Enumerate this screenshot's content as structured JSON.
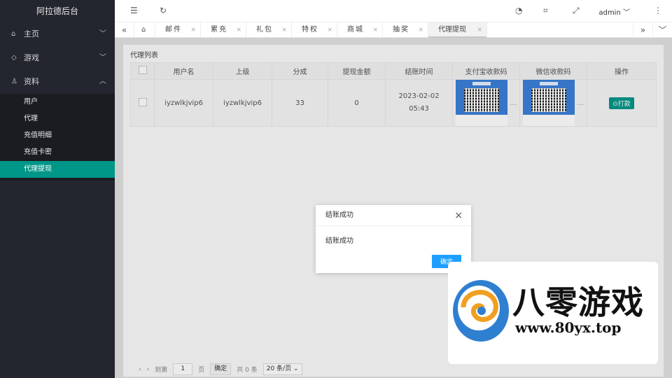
{
  "sidebar": {
    "brand": "阿拉德后台",
    "items": [
      {
        "label": "主页",
        "icon": "home-icon",
        "chevron": "﹀"
      },
      {
        "label": "游戏",
        "icon": "diamond-icon",
        "chevron": "﹀"
      },
      {
        "label": "资料",
        "icon": "user-group-icon",
        "chevron": "︿"
      }
    ],
    "sub_items": [
      "用户",
      "代理",
      "充值明细",
      "充值卡密",
      "代理提现"
    ],
    "active_sub": "代理提现",
    "accent": "#009688"
  },
  "header": {
    "user": "admin"
  },
  "tabs": {
    "items": [
      {
        "label": "邮件"
      },
      {
        "label": "累充"
      },
      {
        "label": "礼包"
      },
      {
        "label": "特权"
      },
      {
        "label": "商城"
      },
      {
        "label": "抽奖"
      },
      {
        "label": "代理提现",
        "active": true
      }
    ]
  },
  "main": {
    "card_title": "代理列表",
    "columns": [
      "用户名",
      "上级",
      "分成",
      "提现金额",
      "结账时间",
      "支付宝收款码",
      "微信收款码",
      "操作"
    ],
    "row": {
      "username": "iyzwlkjvip6",
      "parent": "iyzwlkjvip6",
      "share": "33",
      "amount": "0",
      "time_date": "2023-02-02",
      "time_clock": "05:43",
      "action": "打款"
    },
    "pager": {
      "goto": "到第",
      "page": "1",
      "page_unit": "页",
      "confirm": "确定",
      "total": "共 0 条",
      "per_page": "20 条/页"
    }
  },
  "dialog": {
    "title": "结账成功",
    "message": "结账成功",
    "ok": "确定",
    "ok_color": "#1e9fff"
  },
  "watermark": {
    "title": "八零游戏",
    "url": "www.80yx.top"
  }
}
